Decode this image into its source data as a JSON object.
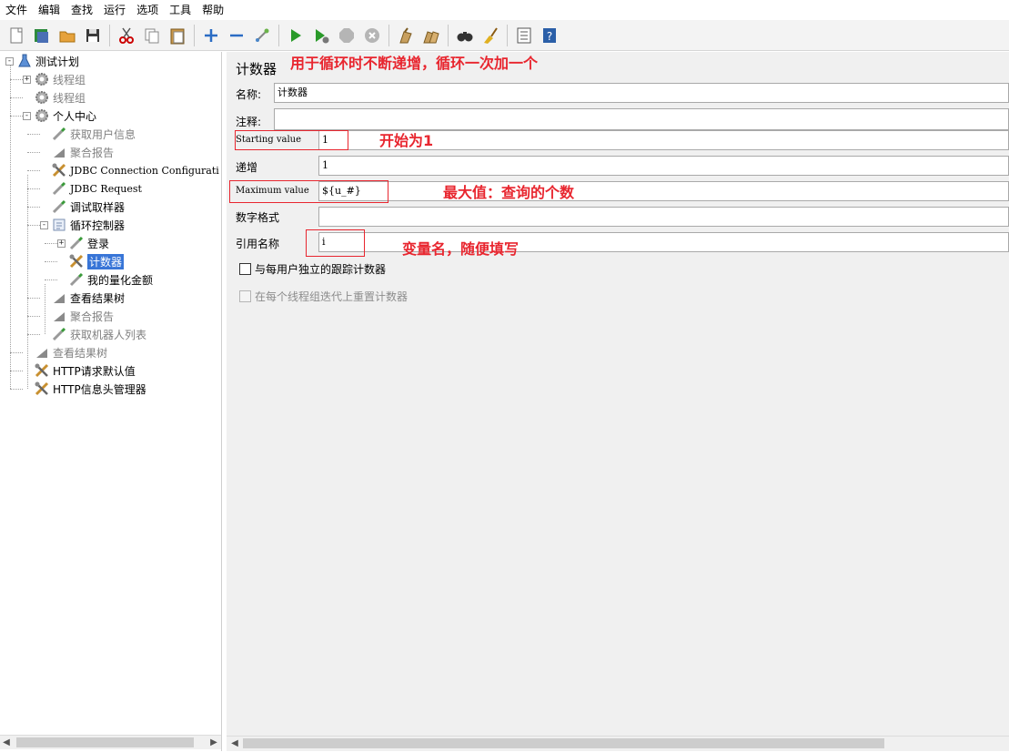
{
  "menu": [
    "文件",
    "编辑",
    "查找",
    "运行",
    "选项",
    "工具",
    "帮助"
  ],
  "toolbar": {
    "icons": [
      "new-icon",
      "templates-icon",
      "open-icon",
      "save-icon",
      "cut-icon",
      "copy-icon",
      "paste-icon",
      "expand-icon",
      "collapse-icon",
      "toggle-icon",
      "start-icon",
      "start-no-pause-icon",
      "stop-icon",
      "shutdown-icon",
      "clear-icon",
      "clear-all-icon",
      "search-icon",
      "reset-search-icon",
      "function-helper-icon",
      "help-icon"
    ]
  },
  "tree": [
    {
      "label": "测试计划",
      "depth": 0,
      "icon": "flask-icon",
      "exp": "-",
      "dim": false
    },
    {
      "label": "线程组",
      "depth": 1,
      "icon": "gear-icon",
      "exp": "+",
      "dim": true
    },
    {
      "label": "线程组",
      "depth": 1,
      "icon": "gear-icon",
      "exp": "",
      "dim": true
    },
    {
      "label": "个人中心",
      "depth": 1,
      "icon": "gear-icon",
      "exp": "-",
      "dim": false
    },
    {
      "label": "获取用户信息",
      "depth": 2,
      "icon": "pipette-icon",
      "exp": "",
      "dim": true
    },
    {
      "label": "聚合报告",
      "depth": 2,
      "icon": "chart-icon",
      "exp": "",
      "dim": true
    },
    {
      "label": "JDBC Connection Configurati",
      "depth": 2,
      "icon": "tools-icon",
      "exp": "",
      "dim": false,
      "mono": true
    },
    {
      "label": "JDBC Request",
      "depth": 2,
      "icon": "pipette-icon",
      "exp": "",
      "dim": false,
      "mono": true
    },
    {
      "label": "调试取样器",
      "depth": 2,
      "icon": "pipette-icon",
      "exp": "",
      "dim": false
    },
    {
      "label": "循环控制器",
      "depth": 2,
      "icon": "loop-icon",
      "exp": "-",
      "dim": false
    },
    {
      "label": "登录",
      "depth": 3,
      "icon": "pipette-icon",
      "exp": "+",
      "dim": false
    },
    {
      "label": "计数器",
      "depth": 3,
      "icon": "tools-icon",
      "exp": "",
      "dim": false,
      "selected": true
    },
    {
      "label": "我的量化金额",
      "depth": 3,
      "icon": "pipette-icon",
      "exp": "",
      "dim": false
    },
    {
      "label": "查看结果树",
      "depth": 2,
      "icon": "chart-icon",
      "exp": "",
      "dim": false
    },
    {
      "label": "聚合报告",
      "depth": 2,
      "icon": "chart-icon",
      "exp": "",
      "dim": true
    },
    {
      "label": "获取机器人列表",
      "depth": 2,
      "icon": "pipette-icon",
      "exp": "",
      "dim": true
    },
    {
      "label": "查看结果树",
      "depth": 1,
      "icon": "chart-icon",
      "exp": "",
      "dim": true
    },
    {
      "label": "HTTP请求默认值",
      "depth": 1,
      "icon": "tools-icon",
      "exp": "",
      "dim": false
    },
    {
      "label": "HTTP信息头管理器",
      "depth": 1,
      "icon": "tools-icon",
      "exp": "",
      "dim": false
    }
  ],
  "panel": {
    "title": "计数器",
    "name_label": "名称:",
    "name_value": "计数器",
    "comment_label": "注释:",
    "comment_value": "",
    "start_label": "Starting value",
    "start_value": "1",
    "increment_label": "递增",
    "increment_value": "1",
    "max_label": "Maximum value",
    "max_value": "${u_#}",
    "format_label": "数字格式",
    "format_value": "",
    "ref_label": "引用名称",
    "ref_value": "i",
    "check1": "与每用户独立的跟踪计数器",
    "check2": "在每个线程组迭代上重置计数器"
  },
  "annotations": {
    "title_note": "用于循环时不断递增，循环一次加一个",
    "start_note": "开始为1",
    "max_note": "最大值：查询的个数",
    "ref_note": "变量名，随便填写"
  },
  "colors": {
    "annotation": "#e8262f",
    "selection": "#3875d7"
  }
}
